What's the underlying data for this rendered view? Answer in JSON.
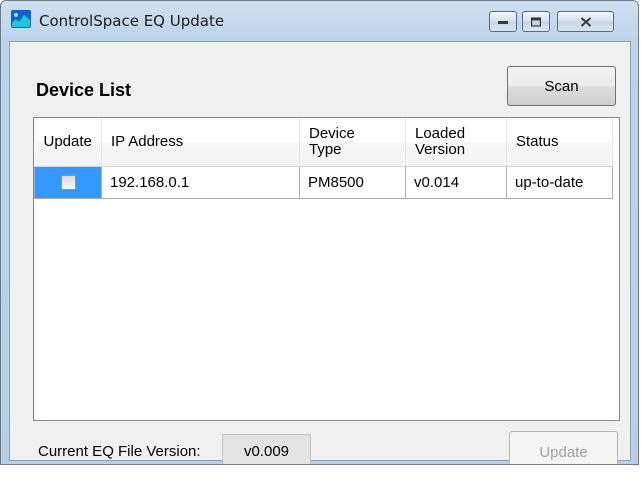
{
  "window": {
    "title": "ControlSpace EQ Update"
  },
  "header": {
    "title": "Device List",
    "scan_label": "Scan"
  },
  "table": {
    "columns": [
      "Update",
      "IP Address",
      "Device\nType",
      "Loaded\nVersion",
      "Status"
    ],
    "rows": [
      {
        "update_checked": false,
        "ip_address": "192.168.0.1",
        "device_type": "PM8500",
        "loaded_version": "v0.014",
        "status": "up-to-date"
      }
    ]
  },
  "footer": {
    "current_version_label": "Current EQ File Version:",
    "current_version_value": "v0.009",
    "update_label": "Update"
  },
  "colors": {
    "selection": "#3399ff",
    "client_bg": "#f0f0f0",
    "frame": "#bdd3ea"
  }
}
